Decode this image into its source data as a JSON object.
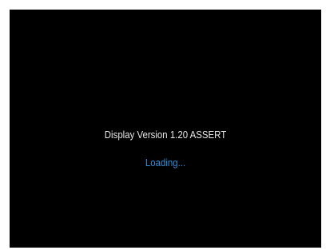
{
  "screen": {
    "version_text": "Display Version 1.20 ASSERT",
    "status_text": "Loading..."
  },
  "colors": {
    "background": "#000000",
    "text": "#e8e8e8",
    "accent": "#2f8fd8"
  }
}
